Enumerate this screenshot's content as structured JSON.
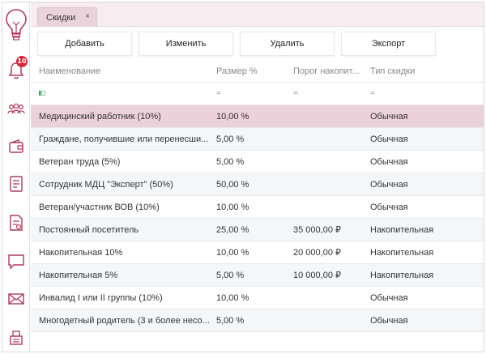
{
  "tab": {
    "label": "Скидки",
    "close": "×"
  },
  "sidebar": {
    "notification_count": "10",
    "icons": [
      "bulb-icon",
      "bell-icon",
      "users-icon",
      "wallet-icon",
      "form-icon",
      "report-icon",
      "chat-icon",
      "mail-icon",
      "cashier-icon"
    ]
  },
  "toolbar": {
    "add": "Добавить",
    "edit": "Изменить",
    "delete": "Удалить",
    "export": "Экспорт"
  },
  "table": {
    "columns": [
      "Наименование",
      "Размер %",
      "Порог накопит...",
      "Тип скидки"
    ],
    "filters": [
      "",
      "=",
      "=",
      "="
    ],
    "rows": [
      {
        "name": "Медицинский работник (10%)",
        "size": "10,00 %",
        "threshold": "",
        "type": "Обычная"
      },
      {
        "name": "Граждане, получившие или перенесши...",
        "size": "5,00 %",
        "threshold": "",
        "type": "Обычная"
      },
      {
        "name": "Ветеран труда (5%)",
        "size": "5,00 %",
        "threshold": "",
        "type": "Обычная"
      },
      {
        "name": "Сотрудник МДЦ \"Эксперт\" (50%)",
        "size": "50,00 %",
        "threshold": "",
        "type": "Обычная"
      },
      {
        "name": "Ветеран/участник ВОВ (10%)",
        "size": "10,00 %",
        "threshold": "",
        "type": "Обычная"
      },
      {
        "name": "Постоянный посетитель",
        "size": "25,00 %",
        "threshold": "35 000,00 ₽",
        "type": "Накопительная"
      },
      {
        "name": "Накопительная 10%",
        "size": "10,00 %",
        "threshold": "20 000,00 ₽",
        "type": "Накопительная"
      },
      {
        "name": "Накопительная 5%",
        "size": "5,00 %",
        "threshold": "10 000,00 ₽",
        "type": "Накопительная"
      },
      {
        "name": "Инвалид I или II группы (10%)",
        "size": "10,00 %",
        "threshold": "",
        "type": "Обычная"
      },
      {
        "name": "Многодетный родитель (3 и более несо...",
        "size": "5,00 %",
        "threshold": "",
        "type": "Обычная"
      }
    ]
  },
  "colors": {
    "accent": "#b23a5a",
    "selected_row": "#ecd0da",
    "tabbar": "#f7ecef",
    "badge": "#d7263d",
    "filter_icon": "#3aa655"
  }
}
